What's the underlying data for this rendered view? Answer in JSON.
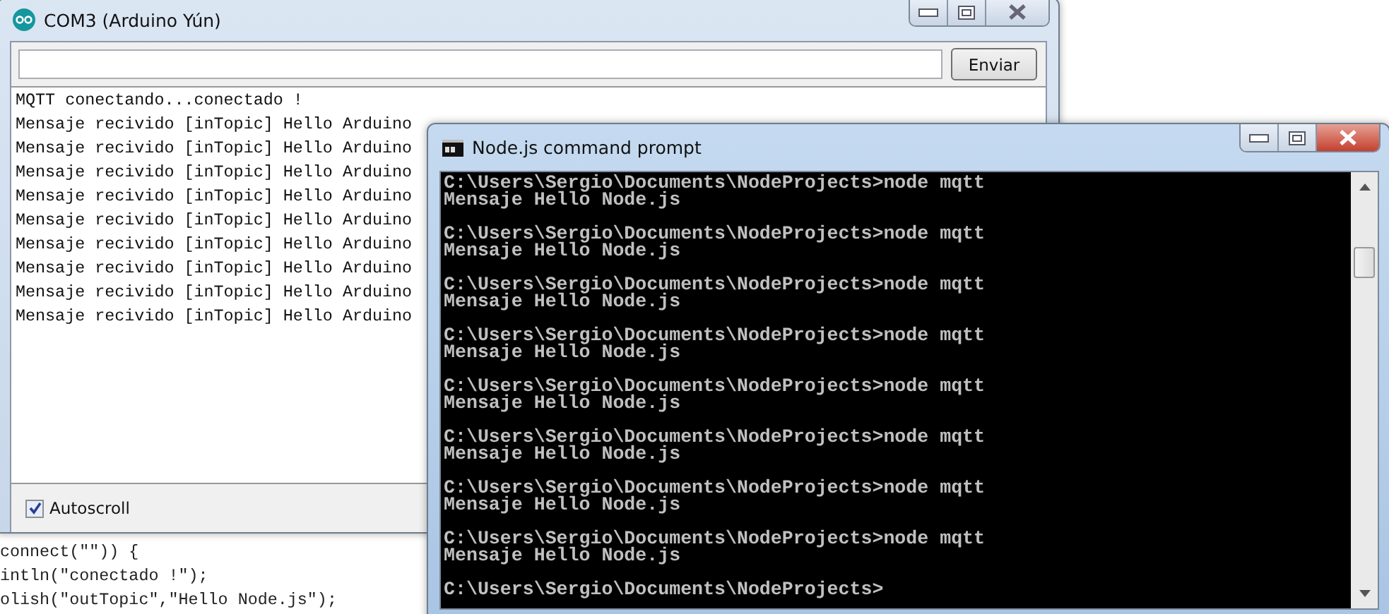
{
  "editor": {
    "lines": [
      "connect(\"\")) {",
      "intln(\"conectado !\");",
      "olish(\"outTopic\",\"Hello Node.js\");"
    ]
  },
  "serial_monitor": {
    "title": "COM3 (Arduino Yún)",
    "send_button": "Enviar",
    "output_lines": [
      "MQTT conectando...conectado !",
      "Mensaje recivido [inTopic] Hello Arduino",
      "Mensaje recivido [inTopic] Hello Arduino",
      "Mensaje recivido [inTopic] Hello Arduino",
      "Mensaje recivido [inTopic] Hello Arduino",
      "Mensaje recivido [inTopic] Hello Arduino",
      "Mensaje recivido [inTopic] Hello Arduino",
      "Mensaje recivido [inTopic] Hello Arduino",
      "Mensaje recivido [inTopic] Hello Arduino",
      "Mensaje recivido [inTopic] Hello Arduino"
    ],
    "autoscroll": {
      "label": "Autoscroll",
      "checked": true
    }
  },
  "command_prompt": {
    "title": "Node.js command prompt",
    "entries": [
      {
        "command": "C:\\Users\\Sergio\\Documents\\NodeProjects>node mqtt",
        "output": "Mensaje Hello Node.js"
      },
      {
        "command": "C:\\Users\\Sergio\\Documents\\NodeProjects>node mqtt",
        "output": "Mensaje Hello Node.js"
      },
      {
        "command": "C:\\Users\\Sergio\\Documents\\NodeProjects>node mqtt",
        "output": "Mensaje Hello Node.js"
      },
      {
        "command": "C:\\Users\\Sergio\\Documents\\NodeProjects>node mqtt",
        "output": "Mensaje Hello Node.js"
      },
      {
        "command": "C:\\Users\\Sergio\\Documents\\NodeProjects>node mqtt",
        "output": "Mensaje Hello Node.js"
      },
      {
        "command": "C:\\Users\\Sergio\\Documents\\NodeProjects>node mqtt",
        "output": "Mensaje Hello Node.js"
      },
      {
        "command": "C:\\Users\\Sergio\\Documents\\NodeProjects>node mqtt",
        "output": "Mensaje Hello Node.js"
      },
      {
        "command": "C:\\Users\\Sergio\\Documents\\NodeProjects>node mqtt",
        "output": "Mensaje Hello Node.js"
      },
      {
        "command": "C:\\Users\\Sergio\\Documents\\NodeProjects>"
      }
    ]
  }
}
